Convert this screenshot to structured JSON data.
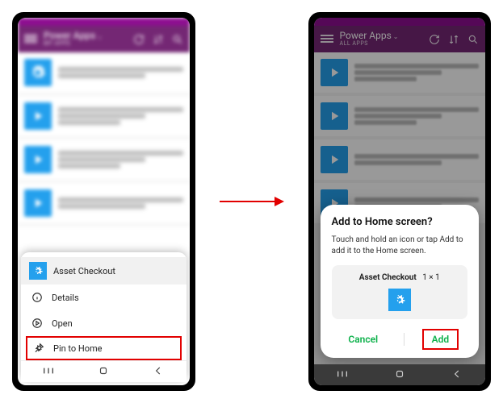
{
  "left": {
    "header": {
      "title": "Power Apps",
      "subtitle": "MY APPS"
    },
    "sheet": {
      "title": "Asset Checkout",
      "details": "Details",
      "open": "Open",
      "pin": "Pin to Home"
    }
  },
  "right": {
    "header": {
      "title": "Power Apps",
      "subtitle": "ALL APPS"
    },
    "dialog": {
      "title": "Add to Home screen?",
      "body": "Touch and hold an icon or tap Add to add it to the Home screen.",
      "preview_name": "Asset Checkout",
      "preview_size": "1 × 1",
      "cancel": "Cancel",
      "add": "Add"
    }
  }
}
